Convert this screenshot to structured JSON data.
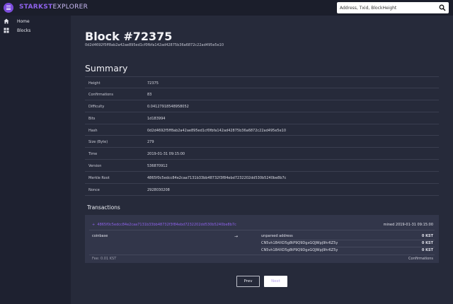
{
  "header": {
    "brand_part1": "STARKST",
    "brand_part2": "EXPLORER",
    "search_placeholder": "Address, Txid, BlockHeight",
    "accent_color": "#7c4ddc",
    "icons": {
      "menu": "menu-icon",
      "search": "search-icon"
    }
  },
  "sidebar": {
    "items": [
      {
        "label": "Home",
        "icon": "home-icon"
      },
      {
        "label": "Blocks",
        "icon": "blocks-icon"
      }
    ]
  },
  "block": {
    "title": "Block #72375",
    "hash": "0d2d4692f5ff8ab2a42ae895ed1cf0fbfa142ad42875b36a6872c22ad495e5e10"
  },
  "summary": {
    "title": "Summary",
    "rows": [
      {
        "key": "Height",
        "value": "72375"
      },
      {
        "key": "Confirmations",
        "value": "83"
      },
      {
        "key": "Difficulty",
        "value": "0.04127918548958052"
      },
      {
        "key": "Bits",
        "value": "1d183994"
      },
      {
        "key": "Hash",
        "value": "0d2d4692f5ff8ab2a42ae895ed1cf0fbfa142ad42875b36a6872c22ad495e5e10"
      },
      {
        "key": "Size (Byte)",
        "value": "279"
      },
      {
        "key": "Time",
        "value": "2019-01-31 09:15:00"
      },
      {
        "key": "Version",
        "value": "536870912"
      },
      {
        "key": "Merkle Root",
        "value": "4865f0c5edcc84e2caa7131b33bb48732f3f84ebd7232202dd530b5240be8b7c"
      },
      {
        "key": "Nonce",
        "value": "2928030208"
      }
    ]
  },
  "transactions": {
    "title": "Transactions",
    "items": [
      {
        "txid": "4865f0c5edcc84e2caa7131b33bb48732f3f84ebd7232202dd530b5240be8b7c",
        "time": "mined 2019-01-31 09:15:00",
        "from": "coinbase",
        "arrow": "→",
        "outputs": [
          {
            "address": "unparsed address",
            "amount": "0 KST"
          },
          {
            "address": "CN5vh1B4XD5g8tP9Q9DgxGQJWpj9hr6Z5y",
            "amount": "0 KST"
          },
          {
            "address": "CN5vh1B4XD5g8tP9Q9DgxGQJWpj9hr6Z5y",
            "amount": "0 KST"
          }
        ],
        "fee": "Fee: 0.01 KST",
        "confirmations_label": "Confirmations"
      }
    ]
  },
  "pagination": {
    "prev": "Prev",
    "next": "Next"
  }
}
